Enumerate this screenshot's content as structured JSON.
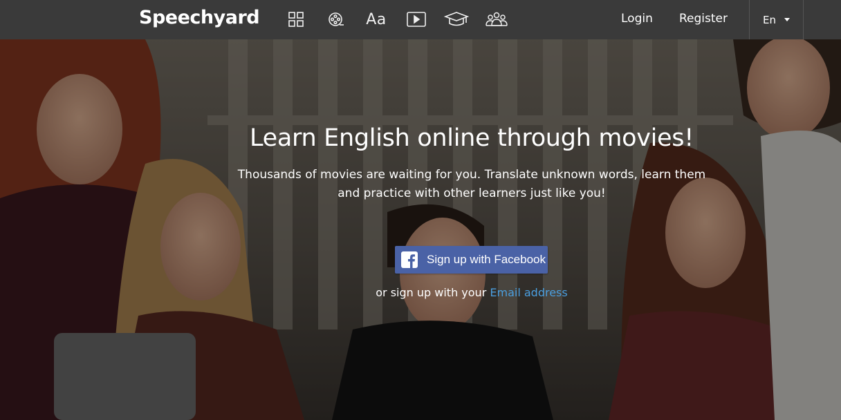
{
  "header": {
    "logo": "Speechyard",
    "nav_icons": [
      {
        "name": "catalog-grid-icon"
      },
      {
        "name": "film-reel-icon"
      },
      {
        "name": "dictionary-icon",
        "text": "Aa"
      },
      {
        "name": "video-play-icon"
      },
      {
        "name": "graduation-cap-icon"
      },
      {
        "name": "community-icon"
      }
    ],
    "login": "Login",
    "register": "Register",
    "language": "En"
  },
  "hero": {
    "title": "Learn English online through movies!",
    "subtitle_line1": "Thousands of movies are waiting for you. Translate unknown words, learn them",
    "subtitle_line2": "and practice with other learners just like you!",
    "facebook_button": "Sign up with Facebook",
    "or_text": "or sign up with your",
    "email_link": "Email address"
  },
  "colors": {
    "topbar": "#3a3a3a",
    "facebook_blue": "#4a62a6",
    "link_blue": "#4a9fe0"
  }
}
